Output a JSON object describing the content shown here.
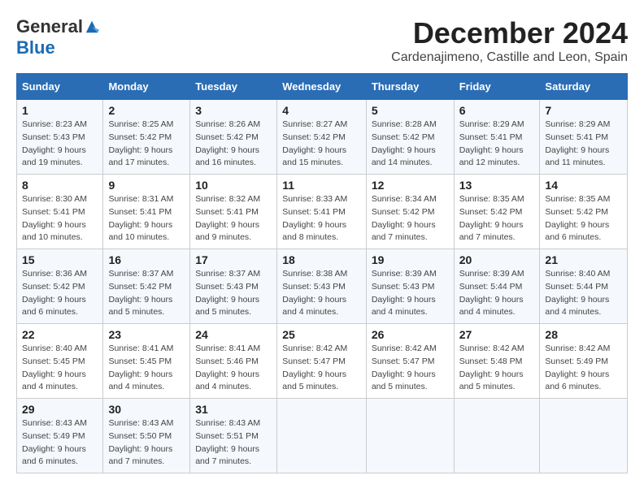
{
  "logo": {
    "general": "General",
    "blue": "Blue"
  },
  "title": {
    "month": "December 2024",
    "location": "Cardenajimeno, Castille and Leon, Spain"
  },
  "weekdays": [
    "Sunday",
    "Monday",
    "Tuesday",
    "Wednesday",
    "Thursday",
    "Friday",
    "Saturday"
  ],
  "weeks": [
    [
      {
        "day": "1",
        "sunrise": "8:23 AM",
        "sunset": "5:43 PM",
        "daylight": "9 hours and 19 minutes."
      },
      {
        "day": "2",
        "sunrise": "8:25 AM",
        "sunset": "5:42 PM",
        "daylight": "9 hours and 17 minutes."
      },
      {
        "day": "3",
        "sunrise": "8:26 AM",
        "sunset": "5:42 PM",
        "daylight": "9 hours and 16 minutes."
      },
      {
        "day": "4",
        "sunrise": "8:27 AM",
        "sunset": "5:42 PM",
        "daylight": "9 hours and 15 minutes."
      },
      {
        "day": "5",
        "sunrise": "8:28 AM",
        "sunset": "5:42 PM",
        "daylight": "9 hours and 14 minutes."
      },
      {
        "day": "6",
        "sunrise": "8:29 AM",
        "sunset": "5:41 PM",
        "daylight": "9 hours and 12 minutes."
      },
      {
        "day": "7",
        "sunrise": "8:29 AM",
        "sunset": "5:41 PM",
        "daylight": "9 hours and 11 minutes."
      }
    ],
    [
      {
        "day": "8",
        "sunrise": "8:30 AM",
        "sunset": "5:41 PM",
        "daylight": "9 hours and 10 minutes."
      },
      {
        "day": "9",
        "sunrise": "8:31 AM",
        "sunset": "5:41 PM",
        "daylight": "9 hours and 10 minutes."
      },
      {
        "day": "10",
        "sunrise": "8:32 AM",
        "sunset": "5:41 PM",
        "daylight": "9 hours and 9 minutes."
      },
      {
        "day": "11",
        "sunrise": "8:33 AM",
        "sunset": "5:41 PM",
        "daylight": "9 hours and 8 minutes."
      },
      {
        "day": "12",
        "sunrise": "8:34 AM",
        "sunset": "5:42 PM",
        "daylight": "9 hours and 7 minutes."
      },
      {
        "day": "13",
        "sunrise": "8:35 AM",
        "sunset": "5:42 PM",
        "daylight": "9 hours and 7 minutes."
      },
      {
        "day": "14",
        "sunrise": "8:35 AM",
        "sunset": "5:42 PM",
        "daylight": "9 hours and 6 minutes."
      }
    ],
    [
      {
        "day": "15",
        "sunrise": "8:36 AM",
        "sunset": "5:42 PM",
        "daylight": "9 hours and 6 minutes."
      },
      {
        "day": "16",
        "sunrise": "8:37 AM",
        "sunset": "5:42 PM",
        "daylight": "9 hours and 5 minutes."
      },
      {
        "day": "17",
        "sunrise": "8:37 AM",
        "sunset": "5:43 PM",
        "daylight": "9 hours and 5 minutes."
      },
      {
        "day": "18",
        "sunrise": "8:38 AM",
        "sunset": "5:43 PM",
        "daylight": "9 hours and 4 minutes."
      },
      {
        "day": "19",
        "sunrise": "8:39 AM",
        "sunset": "5:43 PM",
        "daylight": "9 hours and 4 minutes."
      },
      {
        "day": "20",
        "sunrise": "8:39 AM",
        "sunset": "5:44 PM",
        "daylight": "9 hours and 4 minutes."
      },
      {
        "day": "21",
        "sunrise": "8:40 AM",
        "sunset": "5:44 PM",
        "daylight": "9 hours and 4 minutes."
      }
    ],
    [
      {
        "day": "22",
        "sunrise": "8:40 AM",
        "sunset": "5:45 PM",
        "daylight": "9 hours and 4 minutes."
      },
      {
        "day": "23",
        "sunrise": "8:41 AM",
        "sunset": "5:45 PM",
        "daylight": "9 hours and 4 minutes."
      },
      {
        "day": "24",
        "sunrise": "8:41 AM",
        "sunset": "5:46 PM",
        "daylight": "9 hours and 4 minutes."
      },
      {
        "day": "25",
        "sunrise": "8:42 AM",
        "sunset": "5:47 PM",
        "daylight": "9 hours and 5 minutes."
      },
      {
        "day": "26",
        "sunrise": "8:42 AM",
        "sunset": "5:47 PM",
        "daylight": "9 hours and 5 minutes."
      },
      {
        "day": "27",
        "sunrise": "8:42 AM",
        "sunset": "5:48 PM",
        "daylight": "9 hours and 5 minutes."
      },
      {
        "day": "28",
        "sunrise": "8:42 AM",
        "sunset": "5:49 PM",
        "daylight": "9 hours and 6 minutes."
      }
    ],
    [
      {
        "day": "29",
        "sunrise": "8:43 AM",
        "sunset": "5:49 PM",
        "daylight": "9 hours and 6 minutes."
      },
      {
        "day": "30",
        "sunrise": "8:43 AM",
        "sunset": "5:50 PM",
        "daylight": "9 hours and 7 minutes."
      },
      {
        "day": "31",
        "sunrise": "8:43 AM",
        "sunset": "5:51 PM",
        "daylight": "9 hours and 7 minutes."
      },
      null,
      null,
      null,
      null
    ]
  ],
  "labels": {
    "sunrise": "Sunrise:",
    "sunset": "Sunset:",
    "daylight": "Daylight:"
  }
}
